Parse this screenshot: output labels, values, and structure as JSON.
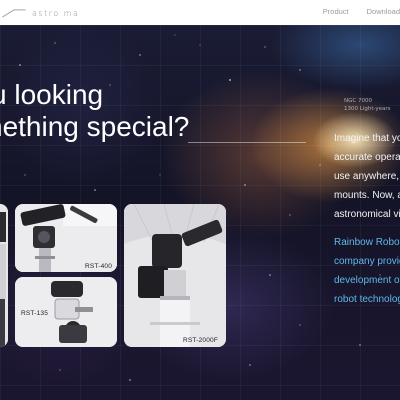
{
  "header": {
    "logo_text": "astro ma",
    "nav": [
      {
        "label": "Product"
      },
      {
        "label": "Download"
      }
    ]
  },
  "hero": {
    "headline_line1": "u looking",
    "headline_line2": "nething special?",
    "nebula_label_line1": "NGC 7000",
    "nebula_label_line2": "1300 Light-years",
    "paragraph1": [
      "Imagine that yo",
      "accurate operati",
      "use anywhere, a",
      "mounts. Now, a",
      "astronomical vi"
    ],
    "paragraph2": [
      "Rainbow Roboti",
      "company provid",
      "development of",
      "robot technolog"
    ]
  },
  "products": [
    {
      "label": "RST-400"
    },
    {
      "label": "RST-135"
    },
    {
      "label": "RST-2000F"
    }
  ],
  "colors": {
    "accent_blue": "#5fb8ec",
    "headline": "#ffffff",
    "card_bg": "#e9e9ec"
  }
}
